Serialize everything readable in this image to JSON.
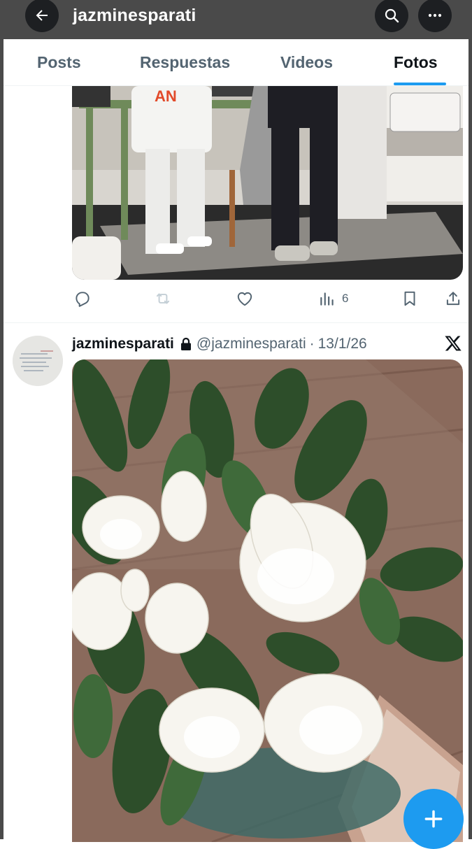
{
  "header": {
    "title": "jazminesparati",
    "back_icon": "arrow-left-icon",
    "search_icon": "search-icon",
    "more_icon": "more-horizontal-icon"
  },
  "tabs": [
    {
      "label": "Posts",
      "active": false
    },
    {
      "label": "Respuestas",
      "active": false
    },
    {
      "label": "Videos",
      "active": false
    },
    {
      "label": "Fotos",
      "active": true
    }
  ],
  "first_post": {
    "actions": {
      "reply_icon": "reply-icon",
      "repost_icon": "repost-icon",
      "like_icon": "heart-icon",
      "views_icon": "views-icon",
      "views_count": "6",
      "bookmark_icon": "bookmark-icon",
      "share_icon": "share-icon"
    }
  },
  "second_post": {
    "display_name": "jazminesparati",
    "protected_icon": "lock-icon",
    "handle": "@jazminesparati",
    "separator": "·",
    "date": "13/1/26",
    "source_icon": "x-logo-icon"
  },
  "fab": {
    "icon": "plus-icon"
  },
  "colors": {
    "accent": "#1d9bf0",
    "header_bg": "#4a4a4a",
    "muted_text": "#536471",
    "primary_text": "#0f1419"
  }
}
